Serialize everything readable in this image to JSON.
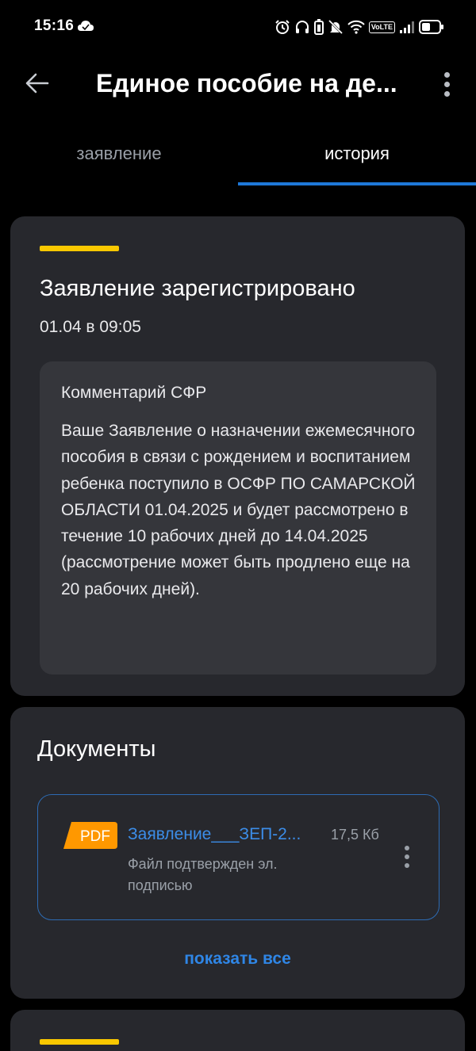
{
  "status_bar": {
    "time": "15:16",
    "volte_label": "VoLTE",
    "icons": [
      "cloud-icon",
      "alarm-icon",
      "headphones-icon",
      "battery-saver-icon",
      "mute-icon",
      "wifi-icon",
      "volte-icon",
      "signal-icon",
      "battery-icon"
    ]
  },
  "app_bar": {
    "title": "Единое пособие на де..."
  },
  "tabs": [
    {
      "label": "заявление",
      "active": false
    },
    {
      "label": "история",
      "active": true
    }
  ],
  "status_card": {
    "title": "Заявление зарегистрировано",
    "date": "01.04 в 09:05",
    "comment": {
      "title": "Комментарий СФР",
      "text": "Ваше Заявление о назначении ежемесячного пособия в связи с рождением и воспитанием ребенка поступило в ОСФР ПО САМАРСКОЙ ОБЛАСТИ 01.04.2025 и будет рассмотрено в течение 10 рабочих дней до 14.04.2025 (рассмотрение может быть продлено еще на 20 рабочих дней)."
    }
  },
  "documents": {
    "title": "Документы",
    "items": [
      {
        "badge": "PDF",
        "name": "Заявление___ЗЕП-2...",
        "size": "17,5 Кб",
        "subtitle": "Файл подтвержден эл. подписью"
      }
    ],
    "show_all_label": "показать все"
  },
  "colors": {
    "background": "#000000",
    "card": "#27282d",
    "accent_blue": "#1e78d8",
    "accent_yellow": "#f9c800",
    "pdf_orange": "#ff9800"
  }
}
